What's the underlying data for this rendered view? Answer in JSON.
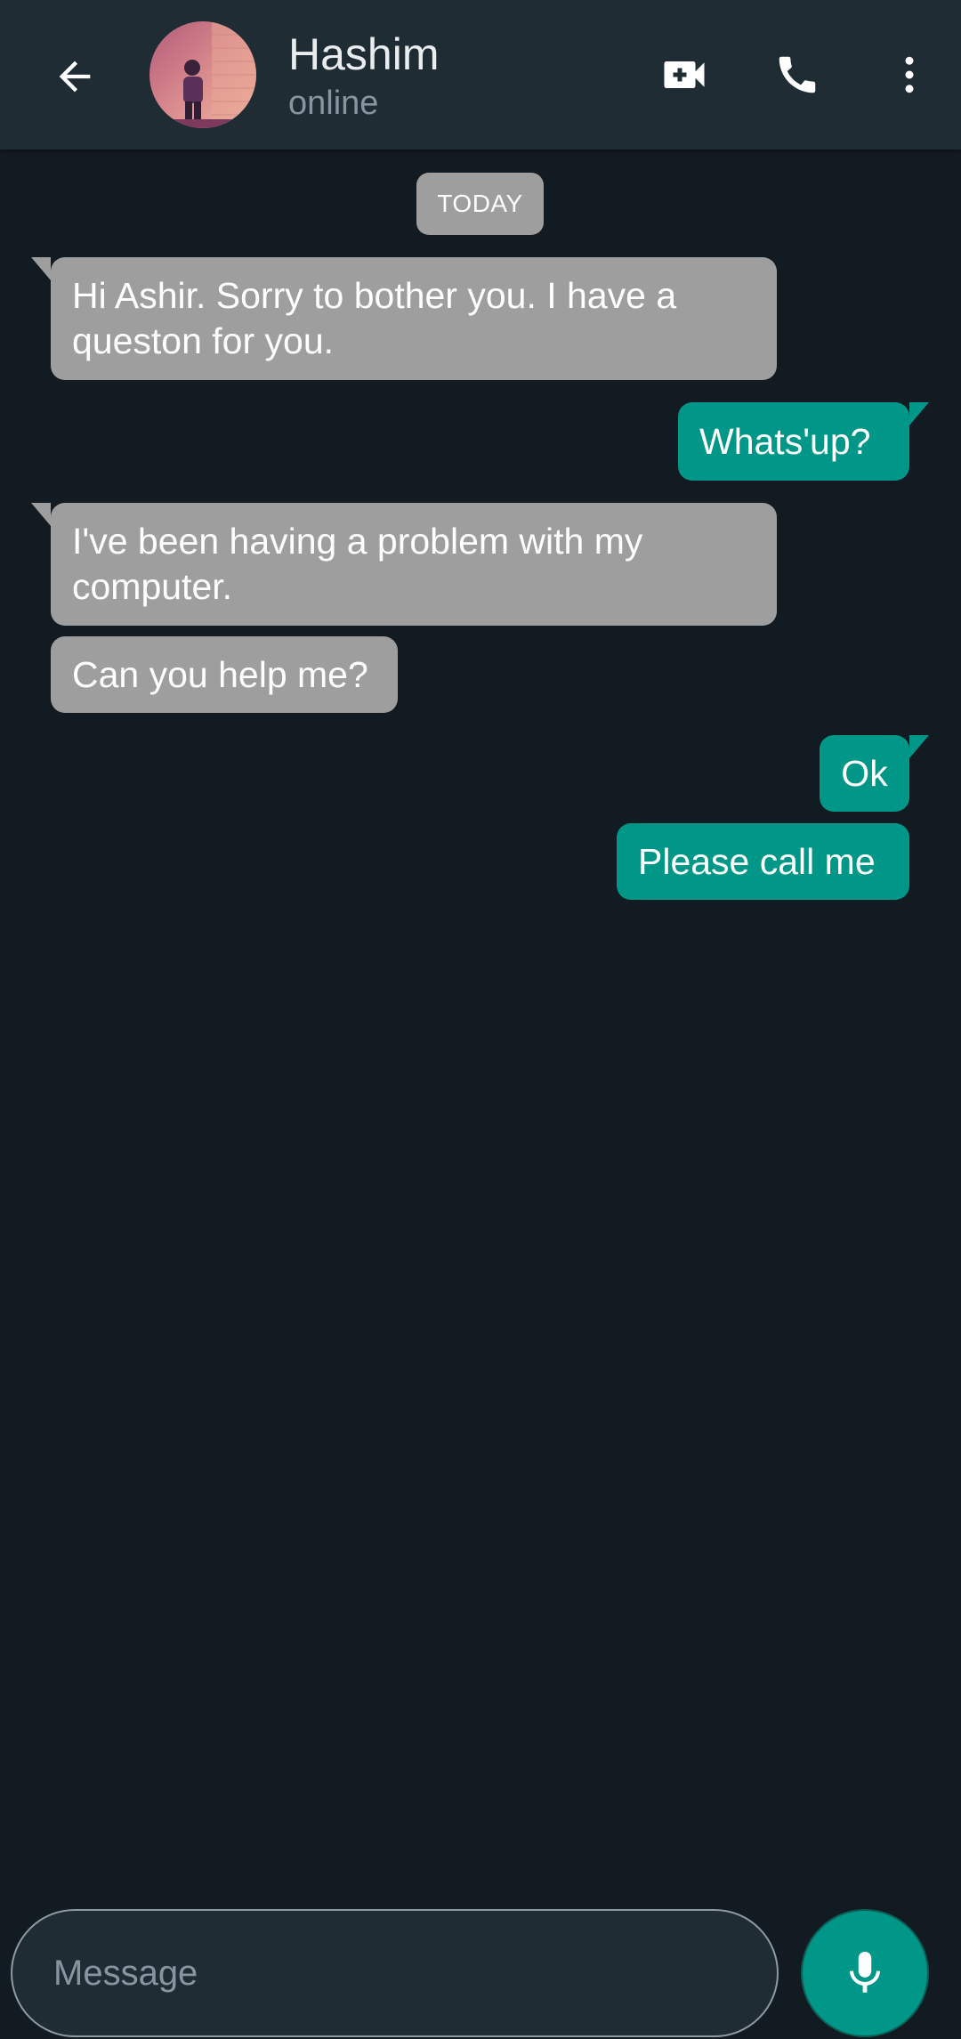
{
  "header": {
    "contact_name": "Hashim",
    "contact_status": "online"
  },
  "chat": {
    "date_divider": "TODAY",
    "messages": [
      {
        "direction": "incoming",
        "text": "Hi Ashir. Sorry to bother you. I have a queston for you."
      },
      {
        "direction": "outgoing",
        "text": "Whats'up?"
      },
      {
        "direction": "incoming",
        "text": "I've been having a problem with my computer."
      },
      {
        "direction": "incoming",
        "text": "Can you help me?"
      },
      {
        "direction": "outgoing",
        "text": "Ok"
      },
      {
        "direction": "outgoing",
        "text": "Please call me"
      }
    ]
  },
  "composer": {
    "placeholder": "Message"
  },
  "icons": {
    "back": "arrow-left-icon",
    "video": "video-camera-icon",
    "call": "phone-icon",
    "more": "more-vertical-icon",
    "mic": "microphone-icon"
  },
  "colors": {
    "background": "#121b22",
    "header": "#1f2c34",
    "incoming_bubble": "#9e9e9e",
    "outgoing_bubble": "#009688",
    "accent": "#009688"
  }
}
